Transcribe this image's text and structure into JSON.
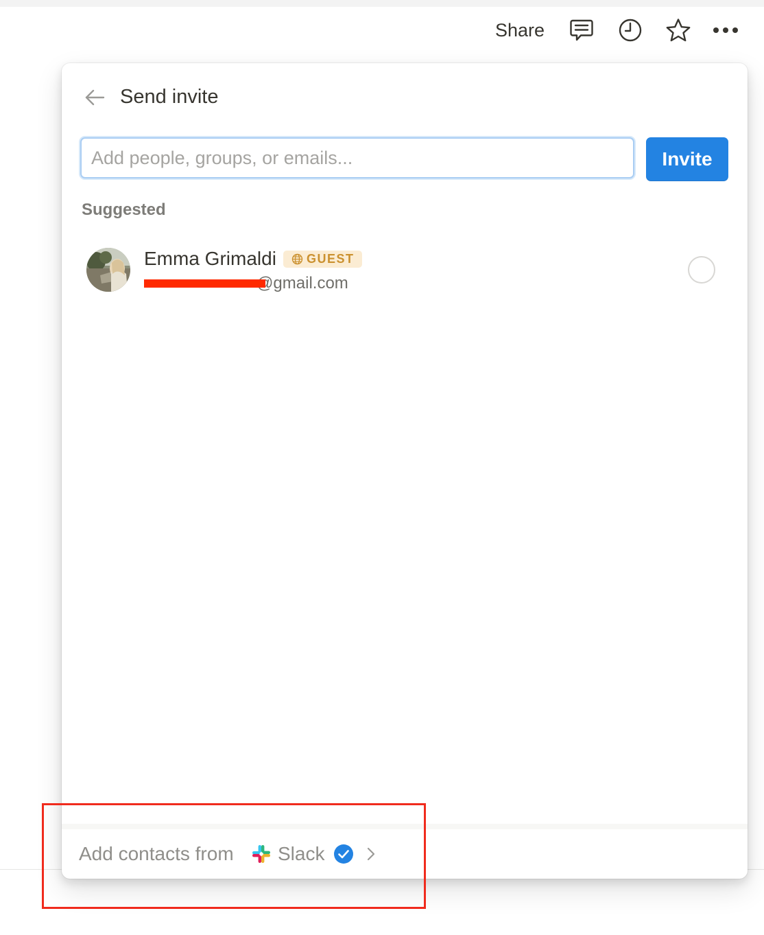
{
  "topbar": {
    "share_label": "Share",
    "icons": [
      "comment-icon",
      "clock-icon",
      "star-icon",
      "more-icon"
    ]
  },
  "popup": {
    "title": "Send invite",
    "search": {
      "value": "",
      "placeholder": "Add people, groups, or emails..."
    },
    "invite_label": "Invite",
    "section_label": "Suggested",
    "suggestions": [
      {
        "name": "Emma Grimaldi",
        "badge": "GUEST",
        "email": "@gmail.com",
        "email_redacted": true
      }
    ],
    "footer": {
      "prefix": "Add contacts from",
      "app": "Slack"
    }
  },
  "colors": {
    "accent": "#2383e2",
    "badge_text": "#cb912f",
    "badge_bg": "#fbecd3",
    "annotation": "#f02b1d",
    "redaction": "#ff2a00"
  }
}
